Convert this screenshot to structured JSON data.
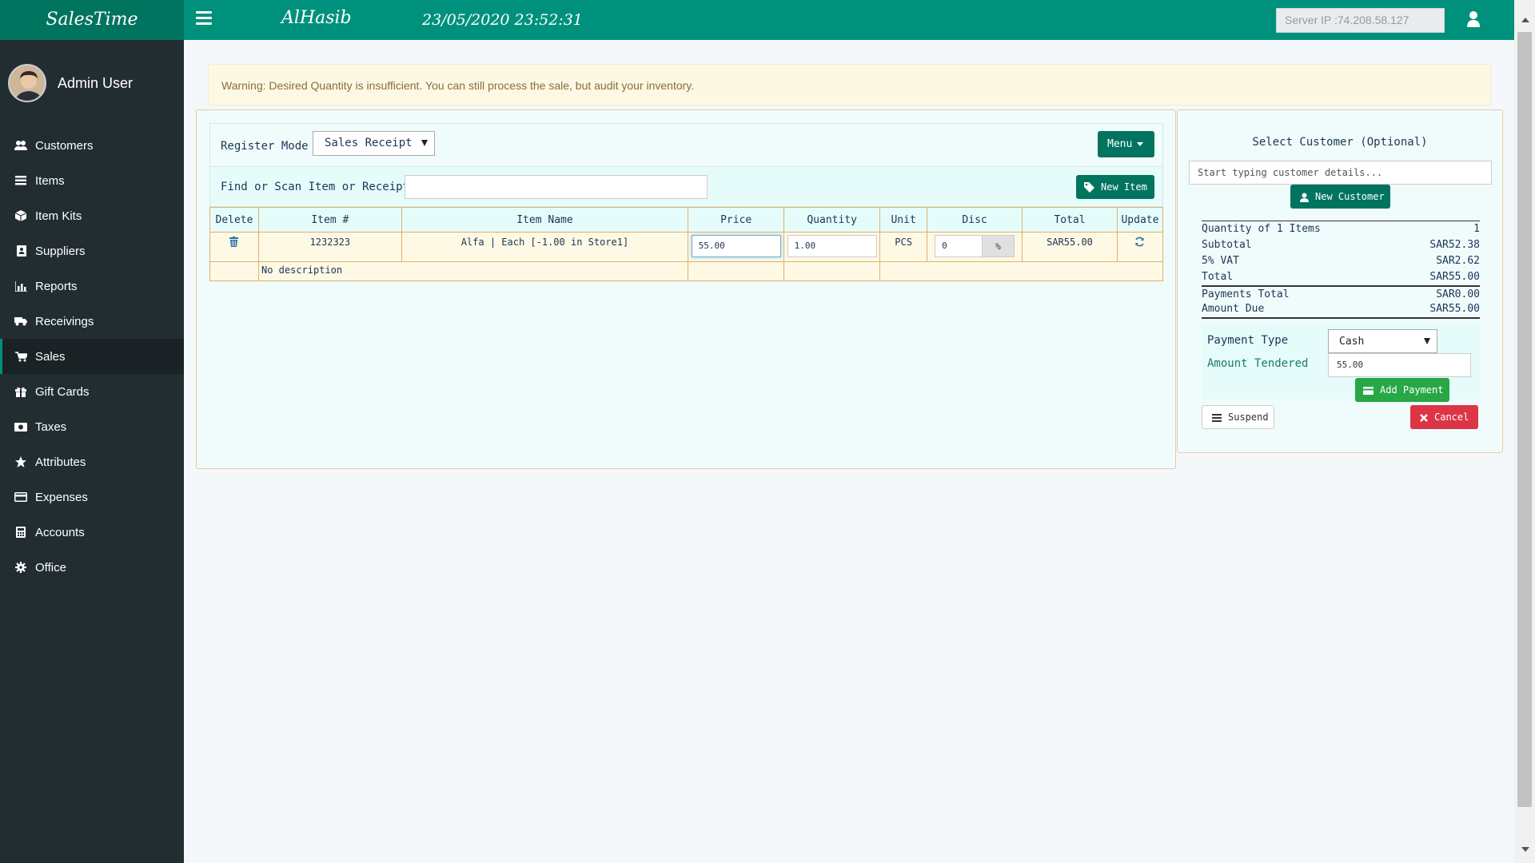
{
  "header": {
    "brand": "SalesTime",
    "company": "AlHasib",
    "datetime": "23/05/2020 23:52:31",
    "server_ip": "Server IP :74.208.58.127"
  },
  "sidebar": {
    "user_name": "Admin User",
    "items": [
      {
        "label": "Customers",
        "icon": "users-icon"
      },
      {
        "label": "Items",
        "icon": "list-icon"
      },
      {
        "label": "Item Kits",
        "icon": "cube-icon"
      },
      {
        "label": "Suppliers",
        "icon": "address-book-icon"
      },
      {
        "label": "Reports",
        "icon": "bar-chart-icon"
      },
      {
        "label": "Receivings",
        "icon": "truck-icon"
      },
      {
        "label": "Sales",
        "icon": "cart-icon",
        "active": true
      },
      {
        "label": "Gift Cards",
        "icon": "gift-icon"
      },
      {
        "label": "Taxes",
        "icon": "money-icon"
      },
      {
        "label": "Attributes",
        "icon": "star-icon"
      },
      {
        "label": "Expenses",
        "icon": "credit-card-icon"
      },
      {
        "label": "Accounts",
        "icon": "calculator-icon"
      },
      {
        "label": "Office",
        "icon": "gear-icon"
      }
    ]
  },
  "warning": "Warning: Desired Quantity is insufficient. You can still process the sale, but audit your inventory.",
  "register": {
    "mode_label": "Register Mode",
    "mode_value": "Sales Receipt",
    "menu_label": "Menu",
    "find_label": "Find or Scan Item or Receipt",
    "find_value": "",
    "new_item_label": "New Item",
    "columns": [
      "Delete",
      "Item #",
      "Item Name",
      "Price",
      "Quantity",
      "Unit",
      "Disc",
      "Total",
      "Update"
    ],
    "row": {
      "item_number": "1232323",
      "item_name": "Alfa | Each [-1.00 in Store1]",
      "price": "55.00",
      "quantity": "1.00",
      "unit": "PCS",
      "discount": "0",
      "discount_type": "%",
      "total": "SAR55.00",
      "description": "No description"
    }
  },
  "customer": {
    "title": "Select Customer (Optional)",
    "placeholder": "Start typing customer details...",
    "new_customer_label": "New Customer"
  },
  "summary": {
    "qty_label": "Quantity of 1 Items",
    "qty_value": "1",
    "subtotal_label": "Subtotal",
    "subtotal_value": "SAR52.38",
    "vat_label": "5% VAT",
    "vat_value": "SAR2.62",
    "total_label": "Total",
    "total_value": "SAR55.00",
    "payments_label": "Payments Total",
    "payments_value": "SAR0.00",
    "due_label": "Amount Due",
    "due_value": "SAR55.00"
  },
  "payment": {
    "type_label": "Payment Type",
    "type_value": "Cash",
    "tendered_label": "Amount Tendered",
    "tendered_value": "55.00",
    "add_payment_label": "Add Payment",
    "suspend_label": "Suspend",
    "cancel_label": "Cancel"
  },
  "colors": {
    "topbar": "#00917c",
    "brand_bg": "#00745f",
    "sidebar": "#222d32",
    "accent_button": "#00745f",
    "success": "#28a745",
    "danger": "#dc3545"
  }
}
